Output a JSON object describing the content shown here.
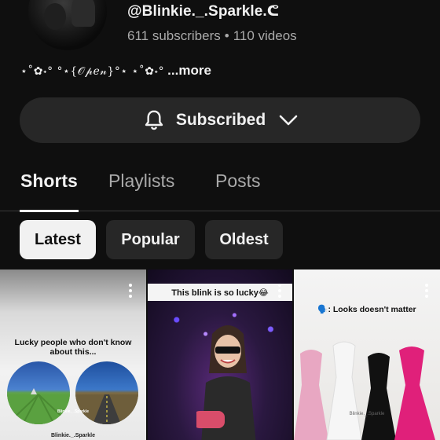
{
  "channel": {
    "handle": "@Blinkie._.Sparkle.ᕦ",
    "subscribers": "611 subscribers",
    "separator": "•",
    "videos": "110 videos",
    "description_deco": "⋆˚✿˖° °⋆{𝒪𝓅𝑒𝓃}°⋆ ⋆˚✿˖°",
    "more_label": "...more"
  },
  "subscribe": {
    "label": "Subscribed",
    "icon": "bell-icon",
    "dropdown_icon": "chevron-down-icon"
  },
  "tabs": [
    {
      "label": "Shorts",
      "active": true
    },
    {
      "label": "Playlists",
      "active": false
    },
    {
      "label": "Posts",
      "active": false
    }
  ],
  "filters": [
    {
      "label": "Latest",
      "selected": true
    },
    {
      "label": "Popular",
      "selected": false
    },
    {
      "label": "Oldest",
      "selected": false
    }
  ],
  "shorts": [
    {
      "caption": "Lucky people who don't know about this...",
      "watermark": "Blinkie._.Sparkle",
      "overlay": "Blinkie._.Sparkle"
    },
    {
      "caption": "This blink is so lucky😂",
      "watermark": ""
    },
    {
      "caption_icon": "🗣️",
      "caption": ": Looks doesn't matter",
      "watermark": "Blinkie._.Sparkle"
    }
  ],
  "colors": {
    "background": "#0f0f0f",
    "surface": "#272727",
    "text": "#f1f1f1",
    "muted": "#aaaaaa"
  }
}
